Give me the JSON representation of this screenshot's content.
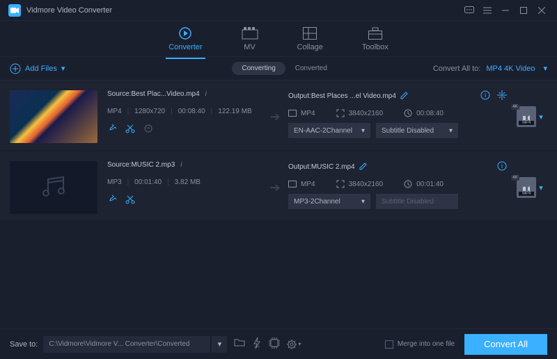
{
  "header": {
    "title": "Vidmore Video Converter"
  },
  "nav": {
    "items": [
      {
        "label": "Converter"
      },
      {
        "label": "MV"
      },
      {
        "label": "Collage"
      },
      {
        "label": "Toolbox"
      }
    ]
  },
  "toolbar": {
    "add_label": "Add Files"
  },
  "tabs": {
    "converting": "Converting",
    "converted": "Converted"
  },
  "convert_all": {
    "label": "Convert All to:",
    "value": "MP4 4K Video"
  },
  "items": [
    {
      "source_name": "Best Plac...Video.mp4",
      "src_format": "MP4",
      "src_res": "1280x720",
      "src_dur": "00:08:40",
      "src_size": "122.19 MB",
      "output_name": "Best Places ...el Video.mp4",
      "out_format": "MP4",
      "out_res": "3840x2160",
      "out_dur": "00:08:40",
      "audio": "EN-AAC-2Channel",
      "subtitle": "Subtitle Disabled",
      "badge_4k": "4K",
      "badge_fmt": "MP4"
    },
    {
      "source_name": "MUSIC 2.mp3",
      "src_format": "MP3",
      "src_res": "",
      "src_dur": "00:01:40",
      "src_size": "3.82 MB",
      "output_name": "MUSIC 2.mp4",
      "out_format": "MP4",
      "out_res": "3840x2160",
      "out_dur": "00:01:40",
      "audio": "MP3-2Channel",
      "subtitle": "Subtitle Disabled",
      "badge_4k": "4K",
      "badge_fmt": "MP4"
    }
  ],
  "footer": {
    "save_label": "Save to:",
    "save_path": "C:\\Vidmore\\Vidmore V... Converter\\Converted",
    "merge_label": "Merge into one file",
    "convert_label": "Convert All"
  },
  "text": {
    "src_prefix": "Source: ",
    "out_prefix": "Output: "
  }
}
